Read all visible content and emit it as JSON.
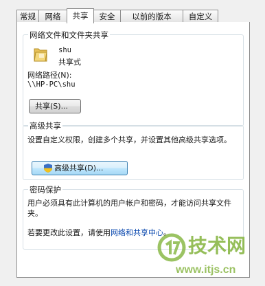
{
  "tabs": [
    "常规",
    "网络",
    "共享",
    "安全",
    "以前的版本",
    "自定义"
  ],
  "active_tab": "共享",
  "network_sharing": {
    "title": "网络文件和文件夹共享",
    "folder_name": "shu",
    "folder_status": "共享式",
    "path_label": "网络路径(N):",
    "path_value": "\\\\HP-PC\\shu",
    "share_button": "共享(S)..."
  },
  "advanced_sharing": {
    "title": "高级共享",
    "description": "设置自定义权限，创建多个共享，并设置其他高级共享选项。",
    "button": "高级共享(D)..."
  },
  "password_protection": {
    "title": "密码保护",
    "description": "用户必须具有此计算机的用户帐户和密码，才能访问共享文件夹。",
    "change_prefix": "若要更改此设置，请使用",
    "change_link": "网络和共享中心",
    "change_suffix": "。"
  },
  "watermark": {
    "brand": "技术网",
    "url": "www.itjs.cn"
  },
  "colors": {
    "link": "#0645ad",
    "watermark": "#8ab848"
  }
}
